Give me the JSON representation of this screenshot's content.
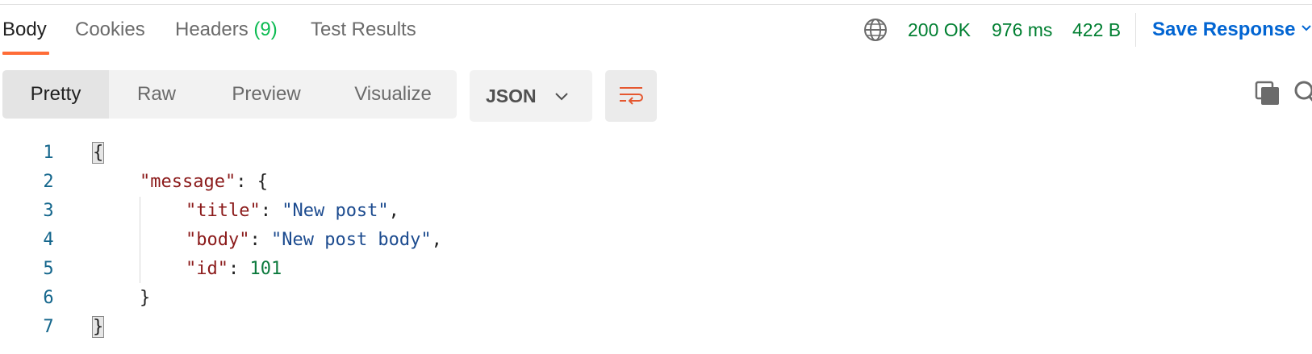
{
  "tabs": [
    {
      "label": "Body",
      "active": true
    },
    {
      "label": "Cookies",
      "active": false
    },
    {
      "label": "Headers",
      "count": "(9)",
      "active": false
    },
    {
      "label": "Test Results",
      "active": false
    }
  ],
  "status": {
    "code": "200 OK",
    "time": "976 ms",
    "size": "422 B",
    "color": "#007f31"
  },
  "save_response_label": "Save Response",
  "view_modes": [
    "Pretty",
    "Raw",
    "Preview",
    "Visualize"
  ],
  "format": {
    "selected": "JSON"
  },
  "icons": {
    "globe": "globe-icon",
    "wrap": "wrap-lines-icon",
    "copy": "copy-icon",
    "search": "search-icon"
  },
  "colors": {
    "accent_tab": "#ff6c37",
    "link_blue": "#0265d2",
    "status_green": "#007f31",
    "json_key": "#8b1a1a",
    "json_string": "#1c4b8f",
    "json_number": "#0c7a3d"
  },
  "code_lines": {
    "numbers": [
      "1",
      "2",
      "3",
      "4",
      "5",
      "6",
      "7"
    ],
    "l1": {
      "brace": "{"
    },
    "l2": {
      "key": "\"message\"",
      "sep": ": ",
      "brace": "{"
    },
    "l3": {
      "key": "\"title\"",
      "sep": ": ",
      "value": "\"New post\"",
      "comma": ","
    },
    "l4": {
      "key": "\"body\"",
      "sep": ": ",
      "value": "\"New post body\"",
      "comma": ","
    },
    "l5": {
      "key": "\"id\"",
      "sep": ": ",
      "value": "101"
    },
    "l6": {
      "brace": "}"
    },
    "l7": {
      "brace": "}"
    }
  }
}
